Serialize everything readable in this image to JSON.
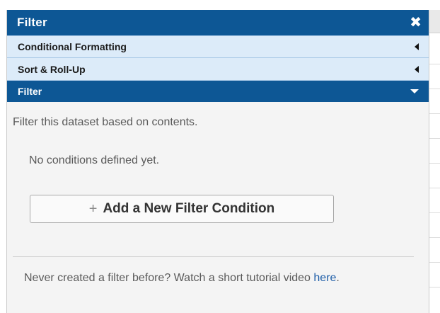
{
  "panel": {
    "title": "Filter",
    "close_glyph": "✖"
  },
  "sections": [
    {
      "label": "Conditional Formatting",
      "state": "collapsed",
      "indicator": "triangle-left-icon"
    },
    {
      "label": "Sort & Roll-Up",
      "state": "collapsed",
      "indicator": "triangle-left-icon"
    },
    {
      "label": "Filter",
      "state": "expanded",
      "indicator": "caret-down-icon"
    }
  ],
  "filter": {
    "description": "Filter this dataset based on contents.",
    "empty_state": "No conditions defined yet.",
    "add_button_plus": "+",
    "add_button_label": "Add a New Filter Condition",
    "tutorial_text": "Never created a filter before? Watch a short tutorial video ",
    "tutorial_link": "here",
    "tutorial_suffix": "."
  },
  "colors": {
    "header_bg": "#0d5795",
    "section_bg": "#dcebf9",
    "panel_bg": "#f4f4f4",
    "link": "#1f5ea8"
  }
}
